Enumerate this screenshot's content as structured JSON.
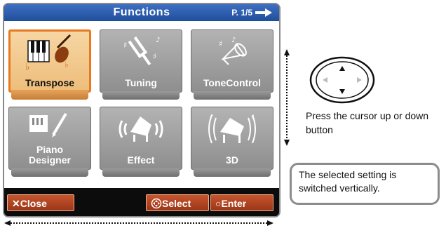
{
  "screen": {
    "title": "Functions",
    "page": "P. 1/5",
    "tiles": [
      {
        "label": "Transpose",
        "selected": true,
        "icon": "transpose-icon"
      },
      {
        "label": "Tuning",
        "selected": false,
        "icon": "tuning-fork-icon"
      },
      {
        "label": "ToneControl",
        "selected": false,
        "icon": "tone-control-icon"
      },
      {
        "label": "Piano",
        "label2": "Designer",
        "selected": false,
        "icon": "piano-designer-icon"
      },
      {
        "label": "Effect",
        "selected": false,
        "icon": "effect-icon"
      },
      {
        "label": "3D",
        "selected": false,
        "icon": "3d-icon"
      }
    ],
    "buttons": {
      "close": "Close",
      "select": "Select",
      "enter": "Enter"
    }
  },
  "annotations": {
    "cursor_hint": "Press the cursor up or down button",
    "note": "The selected setting is switched vertically."
  },
  "colors": {
    "title_bar": "#2f5fb0",
    "selected_tile": "#f2c98d",
    "selected_border": "#e8791f",
    "button": "#b0431f"
  }
}
